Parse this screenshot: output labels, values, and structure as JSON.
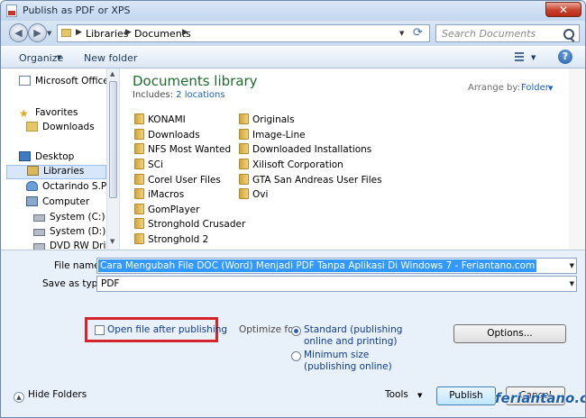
{
  "window": {
    "title": "Publish as PDF or XPS",
    "close_glyph": "✕"
  },
  "nav": {
    "back_glyph": "◀",
    "forward_glyph": "▶",
    "breadcrumb": [
      "Libraries",
      "Documents"
    ],
    "search_placeholder": "Search Documents"
  },
  "toolbar": {
    "organize": "Organize",
    "new_folder": "New folder",
    "help_glyph": "?"
  },
  "sidebar": {
    "items": [
      {
        "label": "Microsoft Office W",
        "icon": "document-icon"
      },
      {
        "label": "Favorites",
        "icon": "star-icon"
      },
      {
        "label": "Downloads",
        "icon": "folder-icon"
      },
      {
        "label": "Desktop",
        "icon": "desktop-icon"
      },
      {
        "label": "Libraries",
        "icon": "library-icon"
      },
      {
        "label": "Octarindo S.P",
        "icon": "user-icon"
      },
      {
        "label": "Computer",
        "icon": "computer-icon"
      },
      {
        "label": "System (C:)",
        "icon": "drive-icon"
      },
      {
        "label": "System (D:)",
        "icon": "drive-icon"
      },
      {
        "label": "DVD RW Drive (",
        "icon": "dvd-drive-icon"
      }
    ]
  },
  "library": {
    "title": "Documents library",
    "includes_label": "Includes:",
    "includes_link": "2 locations",
    "arrange_label": "Arrange by:",
    "arrange_value": "Folder"
  },
  "files": {
    "col1": [
      "KONAMI",
      "Downloads",
      "NFS Most Wanted",
      "SCi",
      "Corel User Files",
      "iMacros",
      "GomPlayer",
      "Stronghold Crusader",
      "Stronghold 2"
    ],
    "col2": [
      "Originals",
      "Image-Line",
      "Downloaded Installations",
      "Xilisoft Corporation",
      "GTA San Andreas User Files",
      "Ovi"
    ]
  },
  "form": {
    "file_name_label": "File name:",
    "file_name_value": "Cara Mengubah File DOC (Word) Menjadi PDF Tanpa Aplikasi Di Windows 7 - Feriantano.com",
    "save_type_label": "Save as type:",
    "save_type_value": "PDF",
    "open_after_label": "Open file after publishing",
    "optimize_label": "Optimize for:",
    "standard_line1": "Standard (publishing",
    "standard_line2": "online and printing)",
    "minimum_line1": "Minimum size",
    "minimum_line2": "(publishing online)",
    "options_button": "Options..."
  },
  "footer": {
    "hide_folders": "Hide Folders",
    "tools": "Tools",
    "publish": "Publish",
    "cancel": "Cancel"
  },
  "watermark": "feriantano.com",
  "colors": {
    "accent": "#3399ff",
    "highlight_box": "#d4232b",
    "library_title": "#1e6a2e"
  }
}
